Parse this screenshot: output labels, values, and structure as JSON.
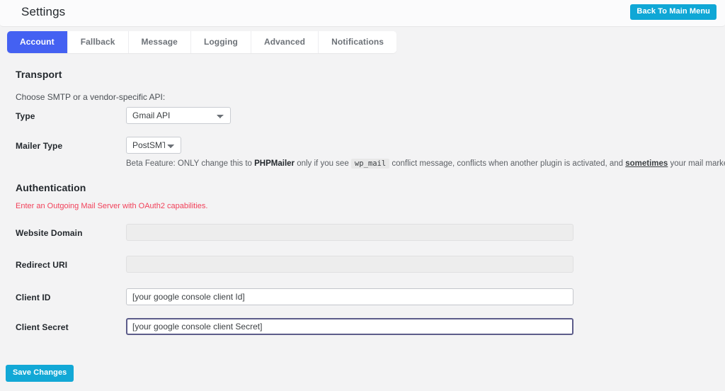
{
  "header": {
    "title": "Settings",
    "back_button": "Back To Main Menu"
  },
  "tabs": [
    {
      "label": "Account",
      "active": true
    },
    {
      "label": "Fallback",
      "active": false
    },
    {
      "label": "Message",
      "active": false
    },
    {
      "label": "Logging",
      "active": false
    },
    {
      "label": "Advanced",
      "active": false
    },
    {
      "label": "Notifications",
      "active": false
    }
  ],
  "transport": {
    "title": "Transport",
    "description": "Choose SMTP or a vendor-specific API:",
    "type_label": "Type",
    "type_value": "Gmail API",
    "type_options": [
      "Gmail API"
    ],
    "mailer_label": "Mailer Type",
    "mailer_value": "PostSMTP",
    "mailer_options": [
      "PostSMTP"
    ],
    "note": {
      "part1": "Beta Feature: ONLY change this to ",
      "bold1": "PHPMailer",
      "part2": " only if you see ",
      "code": "wp_mail",
      "part3": " conflict message, conflicts when another plugin is activated, and ",
      "underline": "sometimes",
      "part4": " your mail marked as spam."
    }
  },
  "authentication": {
    "title": "Authentication",
    "error": "Enter an Outgoing Mail Server with OAuth2 capabilities.",
    "fields": [
      {
        "label": "Website Domain",
        "value": "",
        "disabled": true
      },
      {
        "label": "Redirect URI",
        "value": "",
        "disabled": true
      },
      {
        "label": "Client ID",
        "value": "[your google console client Id]",
        "disabled": false
      },
      {
        "label": "Client Secret",
        "value": "[your google console client Secret]",
        "disabled": false
      }
    ]
  },
  "footer": {
    "save_label": "Save Changes"
  },
  "colors": {
    "accent_tab": "#4461f2",
    "accent_button": "#12a8d6",
    "error": "#f2415a",
    "focus_border": "#5c5c8a"
  }
}
